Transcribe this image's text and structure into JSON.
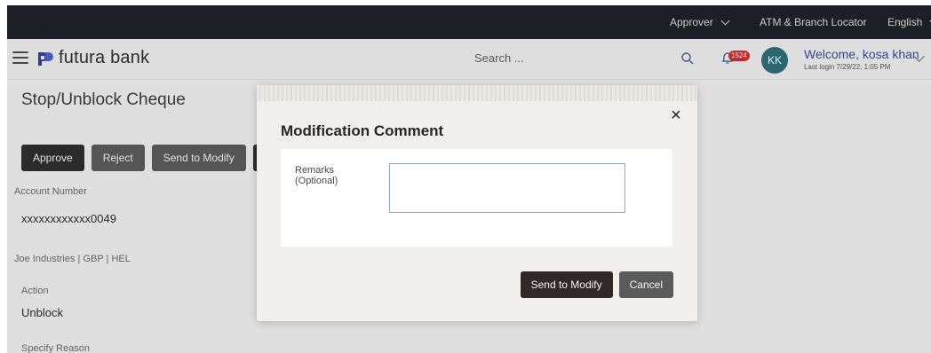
{
  "topbar": {
    "role": "Approver",
    "atm_locator": "ATM & Branch Locator",
    "language": "English"
  },
  "header": {
    "brand": "futura bank",
    "search_placeholder": "Search ...",
    "notification_count": "1524",
    "avatar_initials": "KK",
    "welcome": "Welcome, kosa khan",
    "last_login": "Last login 7/29/22, 1:05 PM"
  },
  "page": {
    "title": "Stop/Unblock Cheque",
    "buttons": {
      "approve": "Approve",
      "reject": "Reject",
      "send_to_modify": "Send to Modify"
    },
    "account_number_label": "Account Number",
    "account_number_value": "xxxxxxxxxxxx0049",
    "account_details": "Joe Industries | GBP | HEL",
    "action_label": "Action",
    "action_value": "Unblock",
    "specify_reason_label": "Specify Reason"
  },
  "modal": {
    "title": "Modification Comment",
    "close_glyph": "×",
    "remarks_label": "Remarks (Optional)",
    "remarks_value": "",
    "primary_button": "Send to Modify",
    "secondary_button": "Cancel"
  },
  "colors": {
    "topbar_bg": "#1d1f26",
    "accent_blue": "#344d9e",
    "badge_red": "#cf2e2e",
    "avatar_teal": "#2b6d78",
    "button_dark": "#2c2c2c"
  }
}
